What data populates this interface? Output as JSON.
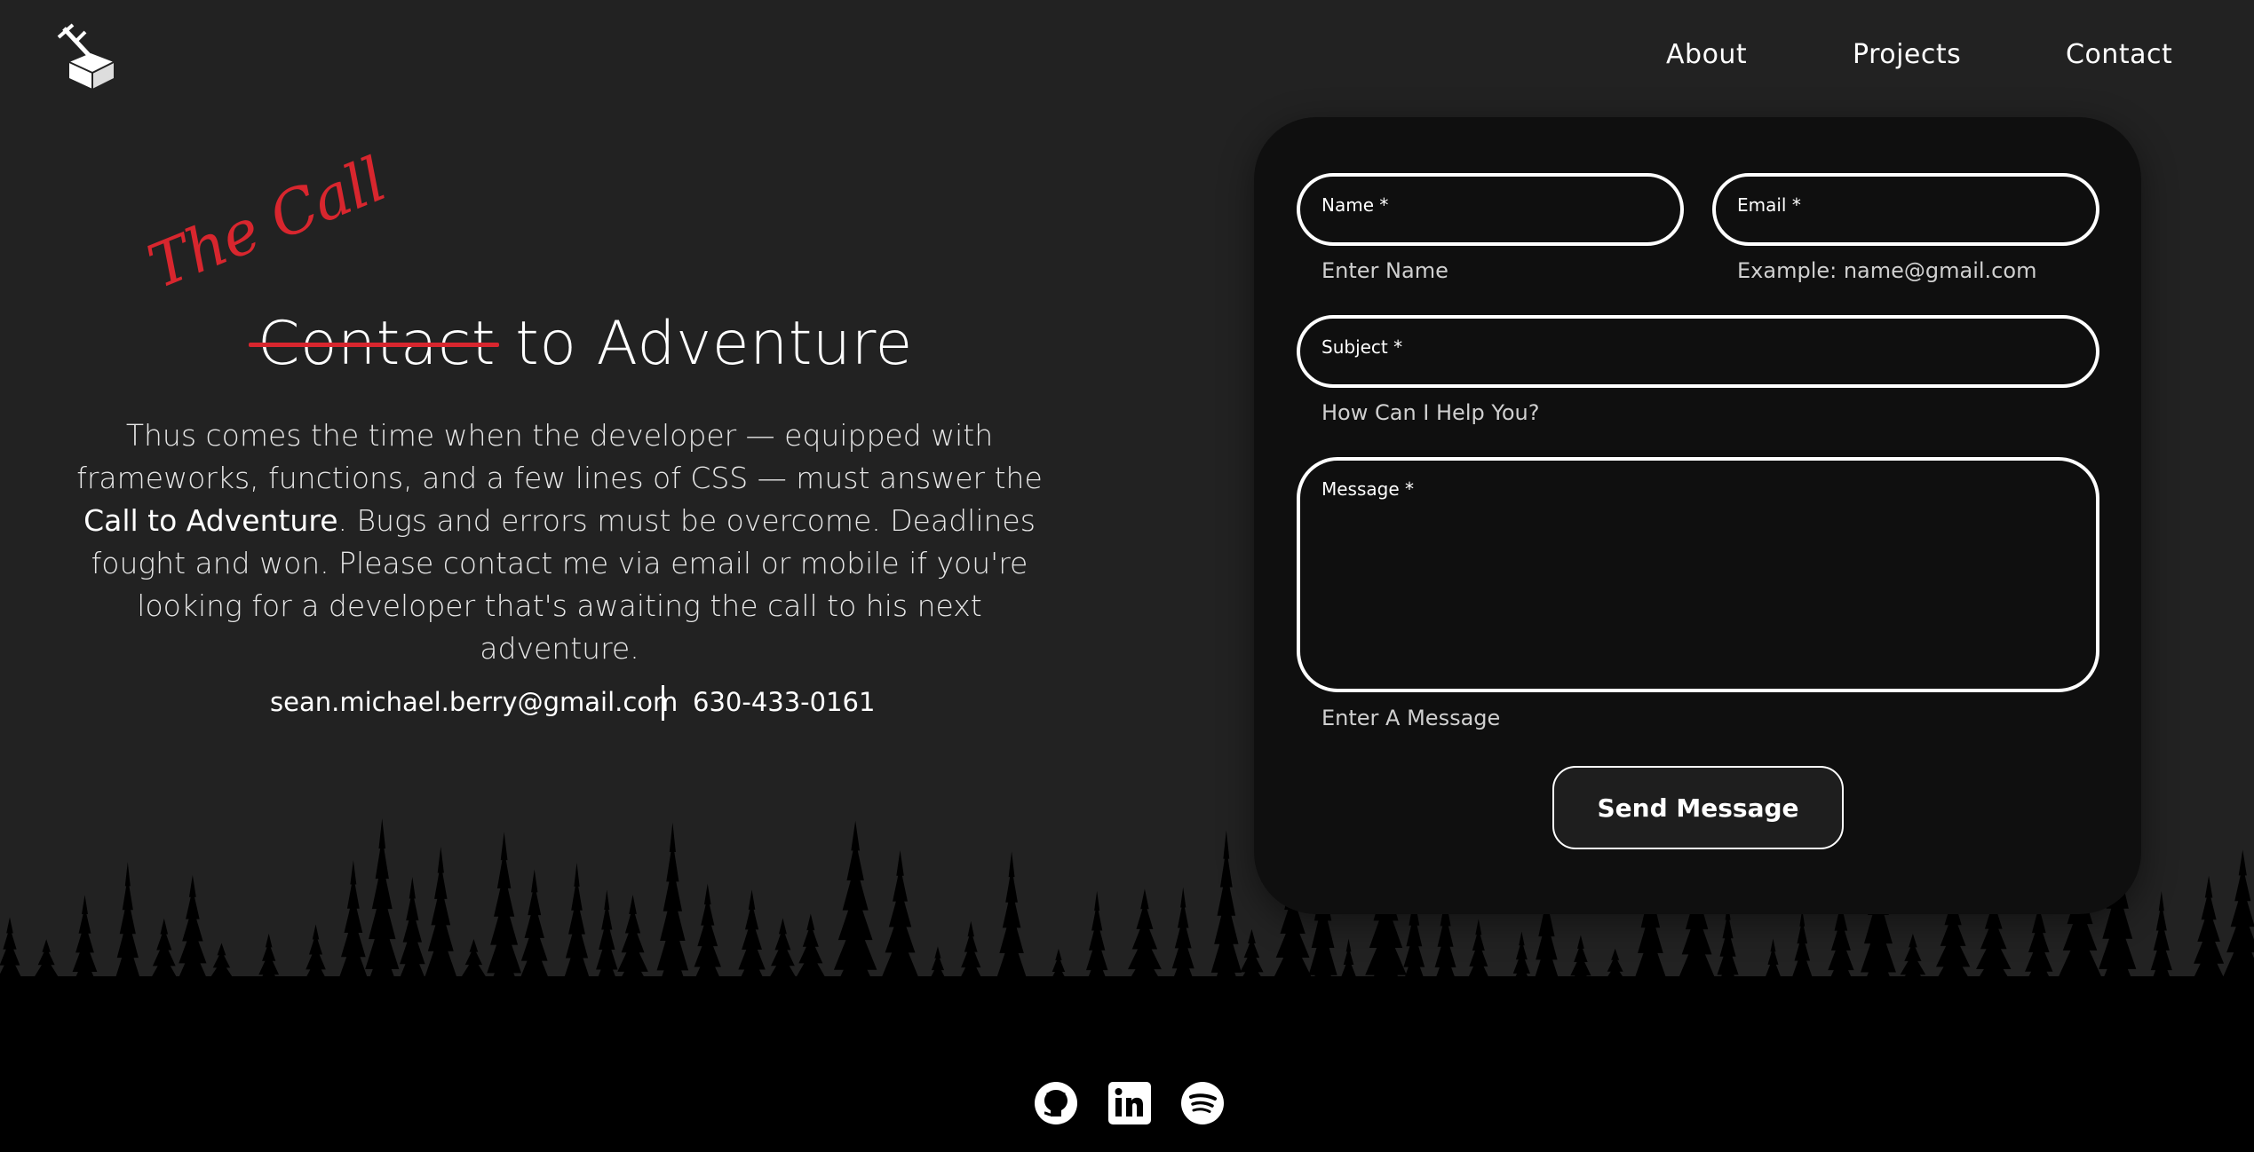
{
  "nav": {
    "logo_icon": "box-and-pickaxe-logo-icon",
    "items": [
      {
        "label": "About"
      },
      {
        "label": "Projects"
      },
      {
        "label": "Contact"
      }
    ]
  },
  "hero": {
    "script_text": "The Call",
    "struck_word": "Contact",
    "headline_rest": " to Adventure",
    "intro_part1": "Thus comes the time when the developer — equipped with frameworks, functions, and a few lines of CSS — must answer the ",
    "intro_bold": "Call to Adventure",
    "intro_part2": ". Bugs and errors must be overcome.  Deadlines fought and won.  Please contact me via email or mobile if you're looking for a developer that's awaiting the call to his next adventure.",
    "email": "sean.michael.berry@gmail.com",
    "phone": "630-433-0161"
  },
  "form": {
    "name_label": "Name *",
    "name_hint": "Enter Name",
    "email_label": "Email *",
    "email_hint": "Example: name@gmail.com",
    "subject_label": "Subject *",
    "subject_hint": "How Can I Help You?",
    "message_label": "Message *",
    "message_hint": "Enter A Message",
    "submit_label": "Send Message"
  },
  "footer": {
    "icons": [
      "github-icon",
      "linkedin-icon",
      "spotify-icon"
    ]
  },
  "colors": {
    "background": "#222222",
    "card": "#0f0f0f",
    "accent": "#d8262e",
    "footer": "#000000"
  }
}
